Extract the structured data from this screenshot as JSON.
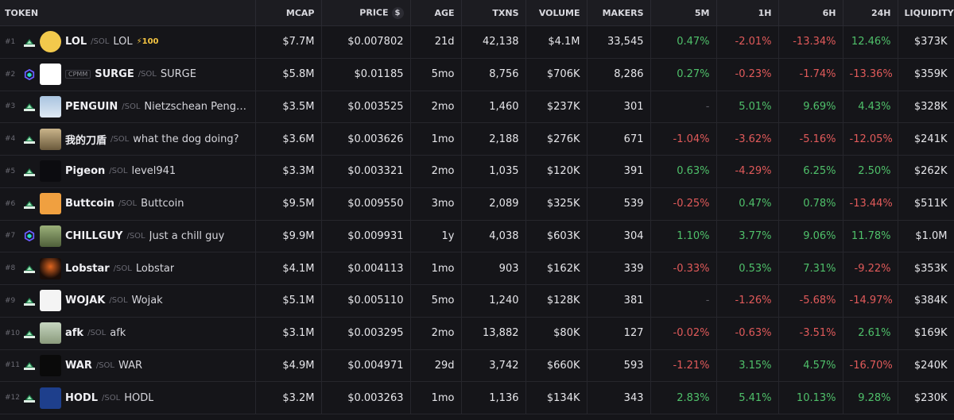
{
  "headers": {
    "token": "TOKEN",
    "mcap": "MCAP",
    "price": "PRICE",
    "age": "AGE",
    "txns": "TXNS",
    "volume": "VOLUME",
    "makers": "MAKERS",
    "m5": "5M",
    "h1": "1H",
    "h6": "6H",
    "h24": "24H",
    "liquidity": "LIQUIDITY"
  },
  "icons": {
    "currency_toggle": "$"
  },
  "colors": {
    "positive": "#4fc06a",
    "negative": "#e15a5a",
    "background": "#151519"
  },
  "rows": [
    {
      "rank": "#1",
      "dex": "pump-dex-icon",
      "cpmm": "",
      "symbol": "LOL",
      "quote": "/SOL",
      "name": "LOL",
      "boost": "⚡100",
      "mcap": "$7.7M",
      "price": "$0.007802",
      "age": "21d",
      "txns": "42,138",
      "volume": "$4.1M",
      "makers": "33,545",
      "m5": "0.47%",
      "h1": "-2.01%",
      "h6": "-13.34%",
      "h24": "12.46%",
      "liquidity": "$373K"
    },
    {
      "rank": "#2",
      "dex": "raydium-dex-icon",
      "cpmm": "CPMM",
      "symbol": "SURGE",
      "quote": "/SOL",
      "name": "SURGE",
      "boost": "",
      "mcap": "$5.8M",
      "price": "$0.01185",
      "age": "5mo",
      "txns": "8,756",
      "volume": "$706K",
      "makers": "8,286",
      "m5": "0.27%",
      "h1": "-0.23%",
      "h6": "-1.74%",
      "h24": "-13.36%",
      "liquidity": "$359K"
    },
    {
      "rank": "#3",
      "dex": "pump-dex-icon",
      "cpmm": "",
      "symbol": "PENGUIN",
      "quote": "/SOL",
      "name": "Nietzschean Penguin",
      "boost": "",
      "mcap": "$3.5M",
      "price": "$0.003525",
      "age": "2mo",
      "txns": "1,460",
      "volume": "$237K",
      "makers": "301",
      "m5": "-",
      "h1": "5.01%",
      "h6": "9.69%",
      "h24": "4.43%",
      "liquidity": "$328K"
    },
    {
      "rank": "#4",
      "dex": "pump-dex-icon",
      "cpmm": "",
      "symbol": "我的刀盾",
      "quote": "/SOL",
      "name": "what the dog doing?",
      "boost": "",
      "mcap": "$3.6M",
      "price": "$0.003626",
      "age": "1mo",
      "txns": "2,188",
      "volume": "$276K",
      "makers": "671",
      "m5": "-1.04%",
      "h1": "-3.62%",
      "h6": "-5.16%",
      "h24": "-12.05%",
      "liquidity": "$241K"
    },
    {
      "rank": "#5",
      "dex": "pump-dex-icon",
      "cpmm": "",
      "symbol": "Pigeon",
      "quote": "/SOL",
      "name": "level941",
      "boost": "",
      "mcap": "$3.3M",
      "price": "$0.003321",
      "age": "2mo",
      "txns": "1,035",
      "volume": "$120K",
      "makers": "391",
      "m5": "0.63%",
      "h1": "-4.29%",
      "h6": "6.25%",
      "h24": "2.50%",
      "liquidity": "$262K"
    },
    {
      "rank": "#6",
      "dex": "pump-dex-icon",
      "cpmm": "",
      "symbol": "Buttcoin",
      "quote": "/SOL",
      "name": "Buttcoin",
      "boost": "",
      "mcap": "$9.5M",
      "price": "$0.009550",
      "age": "3mo",
      "txns": "2,089",
      "volume": "$325K",
      "makers": "539",
      "m5": "-0.25%",
      "h1": "0.47%",
      "h6": "0.78%",
      "h24": "-13.44%",
      "liquidity": "$511K"
    },
    {
      "rank": "#7",
      "dex": "raydium-dex-icon",
      "cpmm": "",
      "symbol": "CHILLGUY",
      "quote": "/SOL",
      "name": "Just a chill guy",
      "boost": "",
      "mcap": "$9.9M",
      "price": "$0.009931",
      "age": "1y",
      "txns": "4,038",
      "volume": "$603K",
      "makers": "304",
      "m5": "1.10%",
      "h1": "3.77%",
      "h6": "9.06%",
      "h24": "11.78%",
      "liquidity": "$1.0M"
    },
    {
      "rank": "#8",
      "dex": "pump-dex-icon",
      "cpmm": "",
      "symbol": "Lobstar",
      "quote": "/SOL",
      "name": "Lobstar",
      "boost": "",
      "mcap": "$4.1M",
      "price": "$0.004113",
      "age": "1mo",
      "txns": "903",
      "volume": "$162K",
      "makers": "339",
      "m5": "-0.33%",
      "h1": "0.53%",
      "h6": "7.31%",
      "h24": "-9.22%",
      "liquidity": "$353K"
    },
    {
      "rank": "#9",
      "dex": "pump-dex-icon",
      "cpmm": "",
      "symbol": "WOJAK",
      "quote": "/SOL",
      "name": "Wojak",
      "boost": "",
      "mcap": "$5.1M",
      "price": "$0.005110",
      "age": "5mo",
      "txns": "1,240",
      "volume": "$128K",
      "makers": "381",
      "m5": "-",
      "h1": "-1.26%",
      "h6": "-5.68%",
      "h24": "-14.97%",
      "liquidity": "$384K"
    },
    {
      "rank": "#10",
      "dex": "pump-dex-icon",
      "cpmm": "",
      "symbol": "afk",
      "quote": "/SOL",
      "name": "afk",
      "boost": "",
      "mcap": "$3.1M",
      "price": "$0.003295",
      "age": "2mo",
      "txns": "13,882",
      "volume": "$80K",
      "makers": "127",
      "m5": "-0.02%",
      "h1": "-0.63%",
      "h6": "-3.51%",
      "h24": "2.61%",
      "liquidity": "$169K"
    },
    {
      "rank": "#11",
      "dex": "pump-dex-icon",
      "cpmm": "",
      "symbol": "WAR",
      "quote": "/SOL",
      "name": "WAR",
      "boost": "",
      "mcap": "$4.9M",
      "price": "$0.004971",
      "age": "29d",
      "txns": "3,742",
      "volume": "$660K",
      "makers": "593",
      "m5": "-1.21%",
      "h1": "3.15%",
      "h6": "4.57%",
      "h24": "-16.70%",
      "liquidity": "$240K"
    },
    {
      "rank": "#12",
      "dex": "pump-dex-icon",
      "cpmm": "",
      "symbol": "HODL",
      "quote": "/SOL",
      "name": "HODL",
      "boost": "",
      "mcap": "$3.2M",
      "price": "$0.003263",
      "age": "1mo",
      "txns": "1,136",
      "volume": "$134K",
      "makers": "343",
      "m5": "2.83%",
      "h1": "5.41%",
      "h6": "10.13%",
      "h24": "9.28%",
      "liquidity": "$230K"
    }
  ]
}
